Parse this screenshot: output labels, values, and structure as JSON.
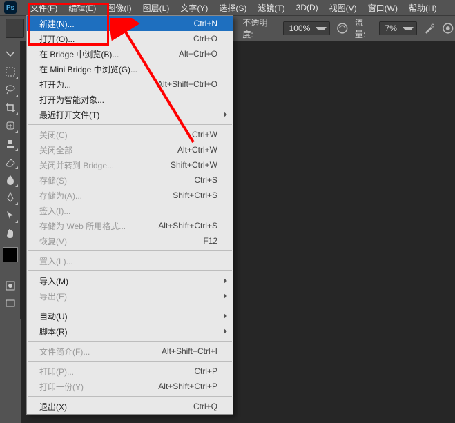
{
  "app_icon": "Ps",
  "menubar": {
    "file": "文件(F)",
    "edit": "编辑(E)",
    "image": "图像(I)",
    "layer": "图层(L)",
    "type": "文字(Y)",
    "select": "选择(S)",
    "filter": "滤镜(T)",
    "threeD": "3D(D)",
    "view": "视图(V)",
    "window": "窗口(W)",
    "help": "帮助(H)"
  },
  "options": {
    "opacity_label": "不透明度:",
    "opacity_value": "100%",
    "flow_label": "流量:",
    "flow_value": "7%"
  },
  "dropdown": {
    "new": {
      "label": "新建(N)...",
      "sc": "Ctrl+N"
    },
    "open": {
      "label": "打开(O)...",
      "sc": "Ctrl+O"
    },
    "browse_bridge": {
      "label": "在 Bridge 中浏览(B)...",
      "sc": "Alt+Ctrl+O"
    },
    "browse_mini": {
      "label": "在 Mini Bridge 中浏览(G)..."
    },
    "open_as": {
      "label": "打开为...",
      "sc": "Alt+Shift+Ctrl+O"
    },
    "open_smart": {
      "label": "打开为智能对象..."
    },
    "recent": {
      "label": "最近打开文件(T)"
    },
    "close": {
      "label": "关闭(C)",
      "sc": "Ctrl+W"
    },
    "close_all": {
      "label": "关闭全部",
      "sc": "Alt+Ctrl+W"
    },
    "close_bridge": {
      "label": "关闭并转到 Bridge...",
      "sc": "Shift+Ctrl+W"
    },
    "save": {
      "label": "存储(S)",
      "sc": "Ctrl+S"
    },
    "save_as": {
      "label": "存储为(A)...",
      "sc": "Shift+Ctrl+S"
    },
    "checkin": {
      "label": "签入(I)..."
    },
    "save_web": {
      "label": "存储为 Web 所用格式...",
      "sc": "Alt+Shift+Ctrl+S"
    },
    "revert": {
      "label": "恢复(V)",
      "sc": "F12"
    },
    "place": {
      "label": "置入(L)..."
    },
    "import": {
      "label": "导入(M)"
    },
    "export": {
      "label": "导出(E)"
    },
    "automate": {
      "label": "自动(U)"
    },
    "scripts": {
      "label": "脚本(R)"
    },
    "fileinfo": {
      "label": "文件简介(F)...",
      "sc": "Alt+Shift+Ctrl+I"
    },
    "print": {
      "label": "打印(P)...",
      "sc": "Ctrl+P"
    },
    "print_one": {
      "label": "打印一份(Y)",
      "sc": "Alt+Shift+Ctrl+P"
    },
    "exit": {
      "label": "退出(X)",
      "sc": "Ctrl+Q"
    }
  }
}
